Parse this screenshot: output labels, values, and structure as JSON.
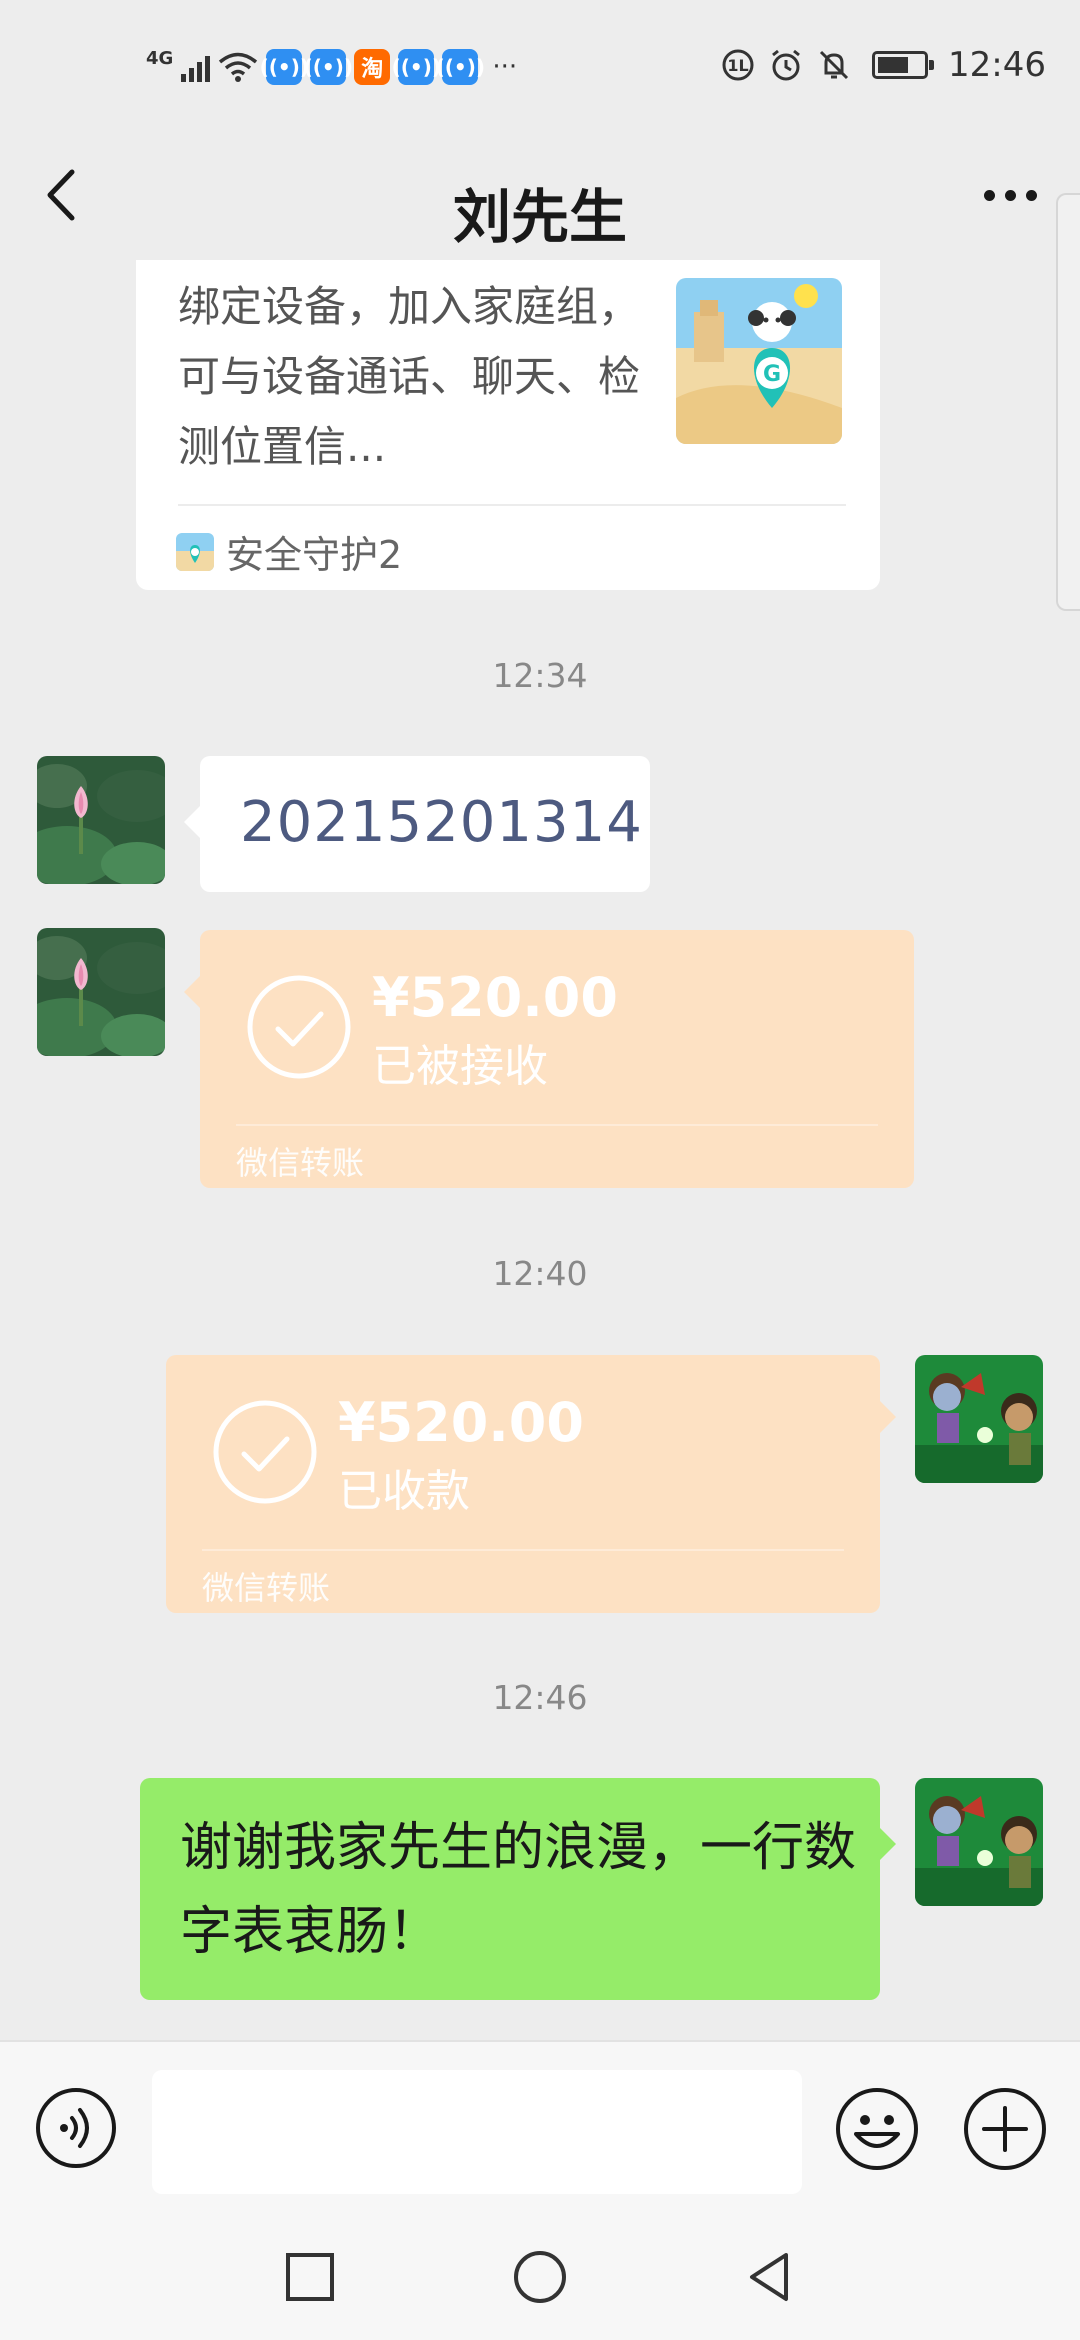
{
  "status_bar": {
    "network": "4G",
    "app_icons": [
      "wifi-hotspot-icon",
      "wifi-hotspot-icon",
      "taobao-icon",
      "wifi-hotspot-icon",
      "wifi-hotspot-icon"
    ],
    "taobao_char": "淘",
    "more": "···",
    "time": "12:46",
    "battery_level": 0.72
  },
  "nav": {
    "title": "刘先生"
  },
  "card": {
    "description": "绑定设备，加入家庭组，可与设备通话、聊天、检测位置信...",
    "source": "安全守护2"
  },
  "messages": {
    "timestamp_1": "12:34",
    "text_received": "20215201314",
    "transfer_received": {
      "amount": "¥520.00",
      "status": "已被接收",
      "footer": "微信转账"
    },
    "timestamp_2": "12:40",
    "transfer_sent": {
      "amount": "¥520.00",
      "status": "已收款",
      "footer": "微信转账"
    },
    "timestamp_3": "12:46",
    "text_sent": "谢谢我家先生的浪漫，一行数字表衷肠！"
  },
  "colors": {
    "background": "#ededed",
    "transfer_bubble": "#fde1c3",
    "sent_bubble": "#95ec69",
    "received_bubble": "#ffffff",
    "timestamp": "#888888"
  }
}
